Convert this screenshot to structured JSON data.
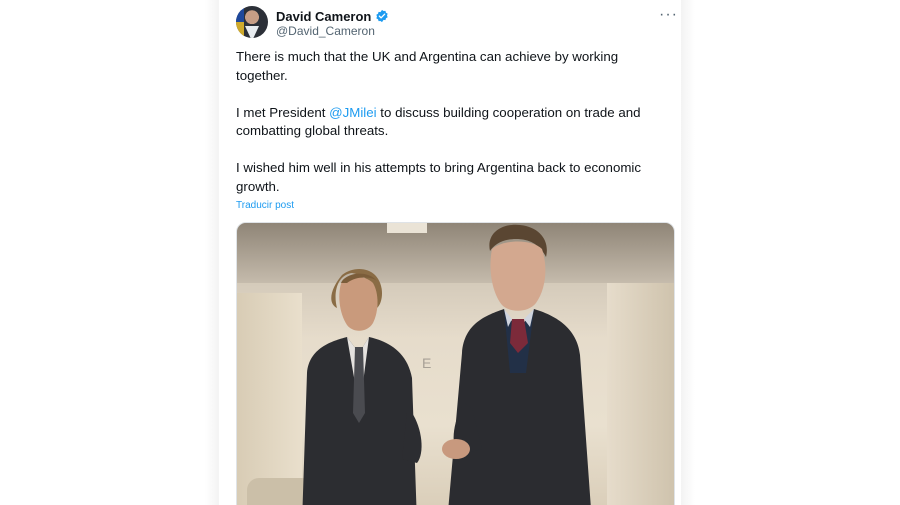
{
  "post": {
    "author_name": "David Cameron",
    "author_handle": "@David_Cameron",
    "paragraph_1": "There is much that the UK and Argentina can achieve by working together.",
    "paragraph_2_prefix": "I met President ",
    "paragraph_2_mention": "@JMilei",
    "paragraph_2_suffix": " to discuss building cooperation on trade and combatting global threats.",
    "paragraph_3": "I wished him well in his attempts to bring Argentina back to economic growth.",
    "translate_label": "Traducir post",
    "more_label": "···"
  },
  "colors": {
    "accent": "#1d9bf0",
    "text": "#0f1419",
    "secondary": "#536471"
  },
  "icons": {
    "verified": "verified-badge-icon",
    "more": "more-options-icon"
  }
}
